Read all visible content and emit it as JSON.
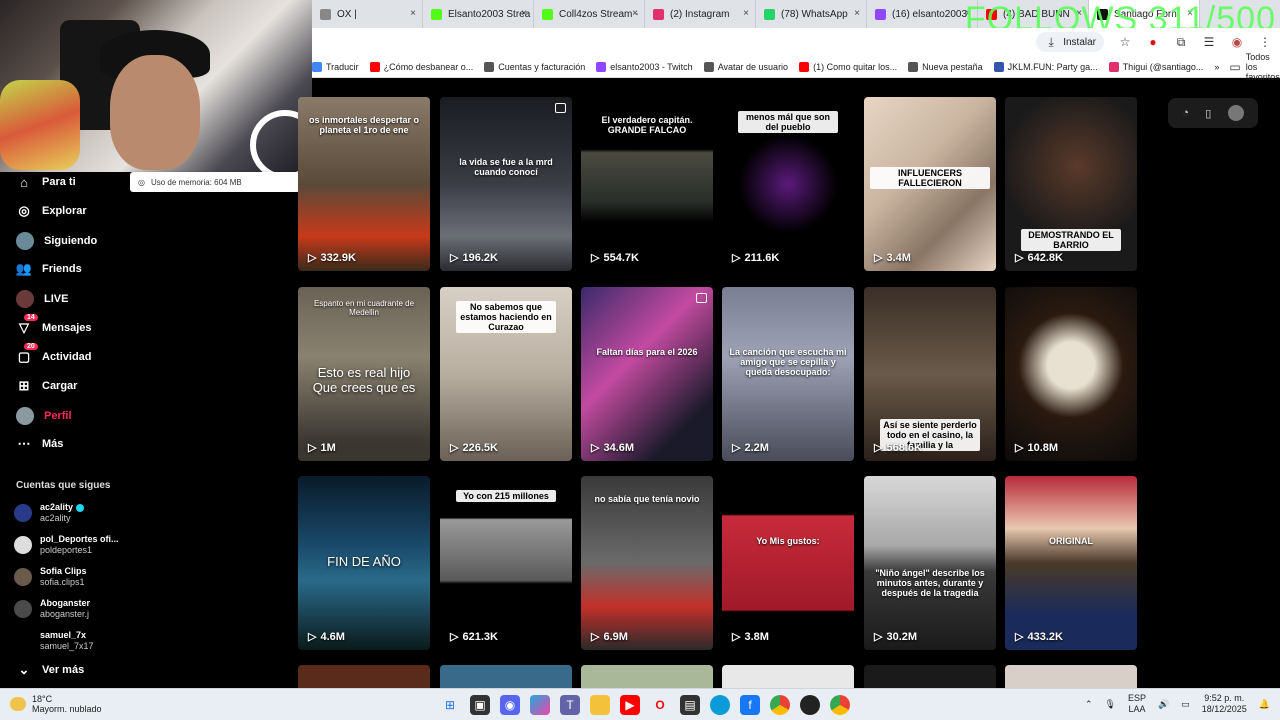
{
  "tabs": [
    {
      "label": "OX |",
      "color": "#888888"
    },
    {
      "label": "Elsanto2003 Strea",
      "color": "#53fc18"
    },
    {
      "label": "Coll4zos Stream -",
      "color": "#53fc18"
    },
    {
      "label": "(2) Instagram",
      "color": "#e1306c"
    },
    {
      "label": "(78) WhatsApp",
      "color": "#25d366"
    },
    {
      "label": "(16) elsanto2003",
      "color": "#9146ff"
    },
    {
      "label": "(4) BAD BUNN",
      "color": "#ff0000"
    },
    {
      "label": "Santiago Forn",
      "color": "#111111",
      "active": true
    }
  ],
  "overlay_text": "FOLLOWS 311/500",
  "omnibar": {
    "install_label": "Instalar"
  },
  "bookmarks": [
    {
      "label": "Traducir",
      "color": "#4285f4"
    },
    {
      "label": "¿Cómo desbanear o...",
      "color": "#ff0000"
    },
    {
      "label": "Cuentas y facturación",
      "color": "#555555"
    },
    {
      "label": "elsanto2003 - Twitch",
      "color": "#9146ff"
    },
    {
      "label": "Avatar de usuario",
      "color": "#555555"
    },
    {
      "label": "(1) Como quitar los...",
      "color": "#ff0000"
    },
    {
      "label": "Nueva pestaña",
      "color": "#555555"
    },
    {
      "label": "JKLM.FUN: Party ga...",
      "color": "#3355aa"
    },
    {
      "label": "Thigui (@santiago...",
      "color": "#e1306c"
    }
  ],
  "bookmarks_more": "»",
  "bookmarks_all": "Todos los favoritos",
  "memory_tooltip": "Uso de memoria: 604 MB",
  "nav": {
    "para_ti": "Para ti",
    "explorar": "Explorar",
    "siguiendo": "Siguiendo",
    "friends": "Friends",
    "live": "LIVE",
    "mensajes": "Mensajes",
    "mensajes_badge": "14",
    "actividad": "Actividad",
    "actividad_badge": "20",
    "cargar": "Cargar",
    "perfil": "Perfil",
    "mas": "Más"
  },
  "following": {
    "title": "Cuentas que sigues",
    "accounts": [
      {
        "name": "ac2ality",
        "handle": "ac2ality",
        "verified": true
      },
      {
        "name": "pol_Deportes ofi...",
        "handle": "poldeportes1"
      },
      {
        "name": "Sofia Clips",
        "handle": "sofia.clips1"
      },
      {
        "name": "Aboganster",
        "handle": "aboganster.j"
      },
      {
        "name": "samuel_7x",
        "handle": "samuel_7x17"
      }
    ],
    "ver_mas": "Ver más"
  },
  "videos": [
    {
      "views": "332.9K",
      "caption": "os inmortales despertar o planeta el 1ro de ene",
      "style": "top",
      "bg": "linear-gradient(180deg,#8a7a6a,#5a4a3a 50%,#c63a1a 80%,#3a2a1a)"
    },
    {
      "views": "196.2K",
      "caption": "la vida se fue a la mrd cuando conocí",
      "style": "mid",
      "bg": "linear-gradient(180deg,#1a1c22,#3a3d45 50%,#6b6e76 80%,#2a2c30)",
      "pic": true
    },
    {
      "views": "554.7K",
      "caption": "El verdadero capitán. GRANDE FALCAO",
      "style": "top",
      "bg": "linear-gradient(180deg,#000 30%,#4a4a40 32%,#2a2f2a 60%,#000 72%)"
    },
    {
      "views": "211.6K",
      "caption": "menos mál que son del pueblo",
      "style": "topbox",
      "bg": "radial-gradient(circle at 50% 50%,#5a1a7a,#000 45%)"
    },
    {
      "views": "3.4M",
      "caption": "INFLUENCERS FALLECIERON",
      "style": "midbox",
      "bg": "linear-gradient(135deg,#e8d5c4,#c9b5a0 40%,#8a7565 70%,#e8d5c4)"
    },
    {
      "views": "642.8K",
      "caption": "DEMOSTRANDO EL BARRIO",
      "style": "lowbox",
      "bg": "radial-gradient(circle at 55% 40%,#5a3a2a,#1a1a1a 60%)"
    },
    {
      "views": "1M",
      "caption": "Esto es real hijo Que crees que es",
      "style": "big",
      "bg": "linear-gradient(180deg,#6a6255,#8a8270 40%,#3a3630 90%)",
      "subcap": "Espanto en mi cuadrante de Medellin"
    },
    {
      "views": "226.5K",
      "caption": "No sabemos que estamos haciendo en Curazao",
      "style": "topbox",
      "bg": "linear-gradient(180deg,#d8d0c5,#b8aea0 50%,#6a6055)"
    },
    {
      "views": "34.6M",
      "caption": "Faltan días para el 2026",
      "style": "mid",
      "bg": "linear-gradient(135deg,#3a2a6a,#c34aa0 40%,#1a1a2a 80%)",
      "pic": true
    },
    {
      "views": "2.2M",
      "caption": "La canción que escucha mi amigo que se cepilla y queda desocupado:",
      "style": "mid",
      "bg": "linear-gradient(180deg,#7a7e92,#9ea2b5 40%,#4a4c5a)"
    },
    {
      "views": "568.6K",
      "caption": "Así se siente perderlo todo en el casino, la familia y la",
      "style": "lowbox",
      "bg": "linear-gradient(180deg,#3a2e26,#6a5a4a 50%,#2a201a)"
    },
    {
      "views": "10.8M",
      "caption": "",
      "style": "none",
      "bg": "radial-gradient(circle at 50% 45%,#e8e0d0 20%,#2a1a10 45%,#0a0a0a)"
    },
    {
      "views": "4.6M",
      "caption": "FIN DE AÑO",
      "style": "big",
      "bg": "linear-gradient(180deg,#0a1a2a,#1a4a6a 40%,#2a6a8a 60%,#0a1a1a)"
    },
    {
      "views": "621.3K",
      "caption": "Yo con 215 millones",
      "style": "topbox",
      "bg": "linear-gradient(180deg,#000 24%,#9a9a9a 25%,#5a5a5a 60%,#000 62%)"
    },
    {
      "views": "6.9M",
      "caption": "no sabía que tenía novio",
      "style": "top",
      "bg": "linear-gradient(180deg,#3a3a3a,#6a6a6a 50%,#c3302a 75%,#2a2a2a)"
    },
    {
      "views": "3.8M",
      "caption": "Yo   Mis gustos:",
      "style": "mid",
      "bg": "linear-gradient(180deg,#000 22%,#c82a3a 23%,#a01a2a 77%,#000 78%)"
    },
    {
      "views": "30.2M",
      "caption": "\"Niño ángel\" describe los minutos antes, durante y después de la tragedia",
      "style": "low",
      "bg": "linear-gradient(180deg,#d8d8d8,#a8a8a8 40%,#3a3a3a 55%,#1a1a1a)"
    },
    {
      "views": "433.2K",
      "caption": "ORIGINAL",
      "style": "mid",
      "bg": "linear-gradient(180deg,#b82a3a,#e8c8b0 30%,#4a3a2a 50%,#1a2a5a 80%)"
    }
  ],
  "taskbar": {
    "temp": "18°C",
    "weather": "Mayorm. nublado",
    "lang": "ESP",
    "lang2": "LAA",
    "time": "9:52 p. m.",
    "date": "18/12/2025"
  }
}
